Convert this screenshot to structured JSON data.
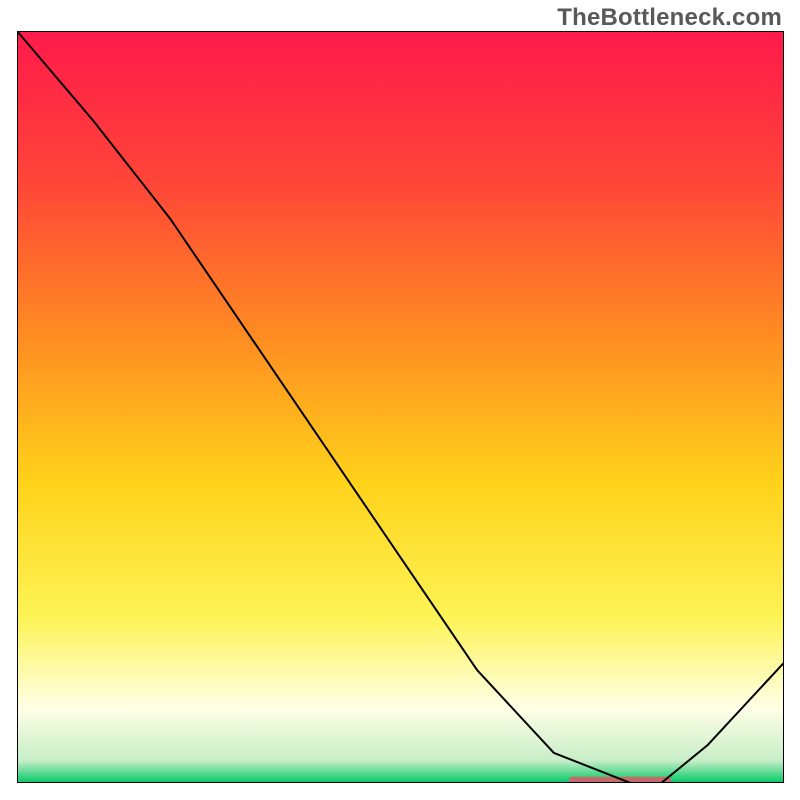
{
  "watermark": "TheBottleneck.com",
  "chart_data": {
    "type": "line",
    "title": "",
    "xlabel": "",
    "ylabel": "",
    "x": [
      0.0,
      0.1,
      0.2,
      0.3,
      0.4,
      0.5,
      0.6,
      0.7,
      0.8,
      0.84,
      0.9,
      1.0
    ],
    "values": [
      1.0,
      0.88,
      0.75,
      0.6,
      0.45,
      0.3,
      0.15,
      0.04,
      0.0,
      0.0,
      0.05,
      0.16
    ],
    "xlim": [
      0,
      1
    ],
    "ylim": [
      0,
      1
    ],
    "gradient_stops": [
      {
        "offset": 0.0,
        "color": "#ff1a4b"
      },
      {
        "offset": 0.2,
        "color": "#ff4538"
      },
      {
        "offset": 0.4,
        "color": "#ff8a22"
      },
      {
        "offset": 0.6,
        "color": "#ffd21a"
      },
      {
        "offset": 0.78,
        "color": "#fdf455"
      },
      {
        "offset": 0.9,
        "color": "#ffffe6"
      },
      {
        "offset": 0.97,
        "color": "#c8eec8"
      },
      {
        "offset": 1.0,
        "color": "#00c864"
      }
    ],
    "valley_marker": {
      "x0": 0.72,
      "x1": 0.853,
      "y": 0.003,
      "color": "#c46a6a"
    },
    "line_color": "#000000",
    "line_width": 2
  }
}
